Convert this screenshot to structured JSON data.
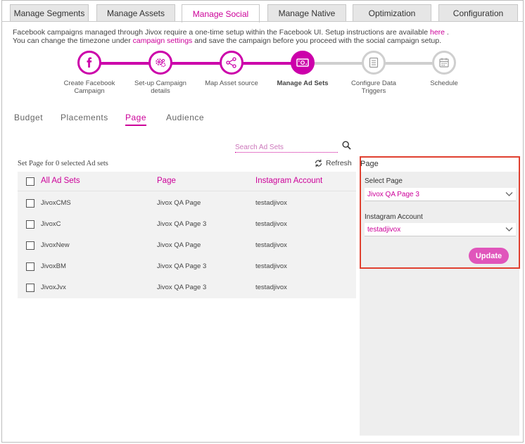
{
  "tabs": [
    {
      "label": "Manage Segments"
    },
    {
      "label": "Manage Assets"
    },
    {
      "label": "Manage Social"
    },
    {
      "label": "Manage Native"
    },
    {
      "label": "Optimization"
    },
    {
      "label": "Configuration"
    }
  ],
  "active_tab": "Manage Social",
  "info": {
    "line1_prefix": "Facebook campaigns managed through Jivox require a one-time setup within the Facebook UI. Setup instructions are available ",
    "line1_link": "here",
    "line1_suffix": " .",
    "line2_prefix": "You can change the timezone under ",
    "line2_link": "campaign settings",
    "line2_suffix": " and save the campaign before you proceed with the social campaign setup."
  },
  "steps": [
    {
      "label": "Create Facebook Campaign",
      "icon": "facebook-icon",
      "state": "done"
    },
    {
      "label": "Set-up Campaign details",
      "icon": "gears-icon",
      "state": "done"
    },
    {
      "label": "Map Asset source",
      "icon": "share-nodes-icon",
      "state": "done"
    },
    {
      "label": "Manage Ad Sets",
      "icon": "money-icon",
      "state": "current"
    },
    {
      "label": "Configure Data Triggers",
      "icon": "list-icon",
      "state": "pending"
    },
    {
      "label": "Schedule",
      "icon": "calendar-icon",
      "state": "pending"
    }
  ],
  "subtabs": [
    {
      "label": "Budget"
    },
    {
      "label": "Placements"
    },
    {
      "label": "Page"
    },
    {
      "label": "Audience"
    }
  ],
  "active_subtab": "Page",
  "search": {
    "placeholder": "Search Ad Sets",
    "value": ""
  },
  "set_info": "Set Page for 0 selected Ad sets",
  "refresh_label": "Refresh",
  "table": {
    "headers": [
      "All Ad Sets",
      "Page",
      "Instagram Account"
    ],
    "rows": [
      {
        "name": "JivoxCMS",
        "page": "Jivox QA Page",
        "instagram": "testadjivox"
      },
      {
        "name": "JivoxC",
        "page": "Jivox QA Page 3",
        "instagram": "testadjivox"
      },
      {
        "name": "JivoxNew",
        "page": "Jivox QA Page",
        "instagram": "testadjivox"
      },
      {
        "name": "JivoxBM",
        "page": "Jivox QA Page 3",
        "instagram": "testadjivox"
      },
      {
        "name": "JivoxJvx",
        "page": "Jivox QA Page 3",
        "instagram": "testadjivox"
      }
    ]
  },
  "panel": {
    "title": "Page",
    "select_page_label": "Select Page",
    "select_page_value": "Jivox QA Page 3",
    "instagram_label": "Instagram Account",
    "instagram_value": "testadjivox",
    "update_label": "Update"
  },
  "colors": {
    "accent": "#cc0099",
    "step_active": "#cc00aa",
    "step_pending": "#cfcfcf",
    "highlight_border": "#e04030",
    "update_button": "#e055bb"
  }
}
